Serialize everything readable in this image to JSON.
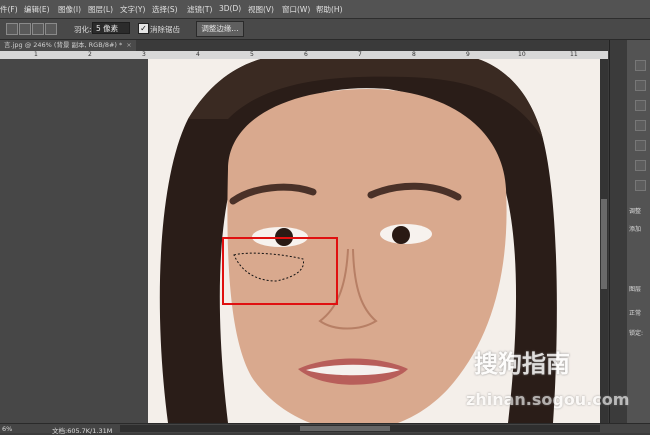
{
  "menubar": {
    "items": [
      "件(F)",
      "编辑(E)",
      "图像(I)",
      "图层(L)",
      "文字(Y)",
      "选择(S)",
      "滤镜(T)",
      "3D(D)",
      "视图(V)",
      "窗口(W)",
      "帮助(H)"
    ]
  },
  "options": {
    "feather_label": "羽化:",
    "feather_value": "5 像素",
    "antialias_label": "消除锯齿",
    "antialias_checked": true,
    "refine_edge_button": "调整边缘..."
  },
  "document": {
    "tab_title": "言.jpg @ 246% (背景 副本, RGB/8#) *",
    "close_symbol": "×",
    "ruler_numbers": [
      "1",
      "2",
      "3",
      "4",
      "5",
      "6",
      "7",
      "8",
      "9",
      "10",
      "11"
    ]
  },
  "right_panel": {
    "labels": [
      "调整",
      "添加",
      "图层",
      "正常",
      "锁定:"
    ]
  },
  "status": {
    "zoom": "6%",
    "doc_info": "文档:605.7K/1.31M"
  },
  "watermark": {
    "text": "搜狗指南",
    "url": "zhinan.sogou.com"
  },
  "colors": {
    "selection_box": "#e01010",
    "accent": "#d0d0d0"
  }
}
